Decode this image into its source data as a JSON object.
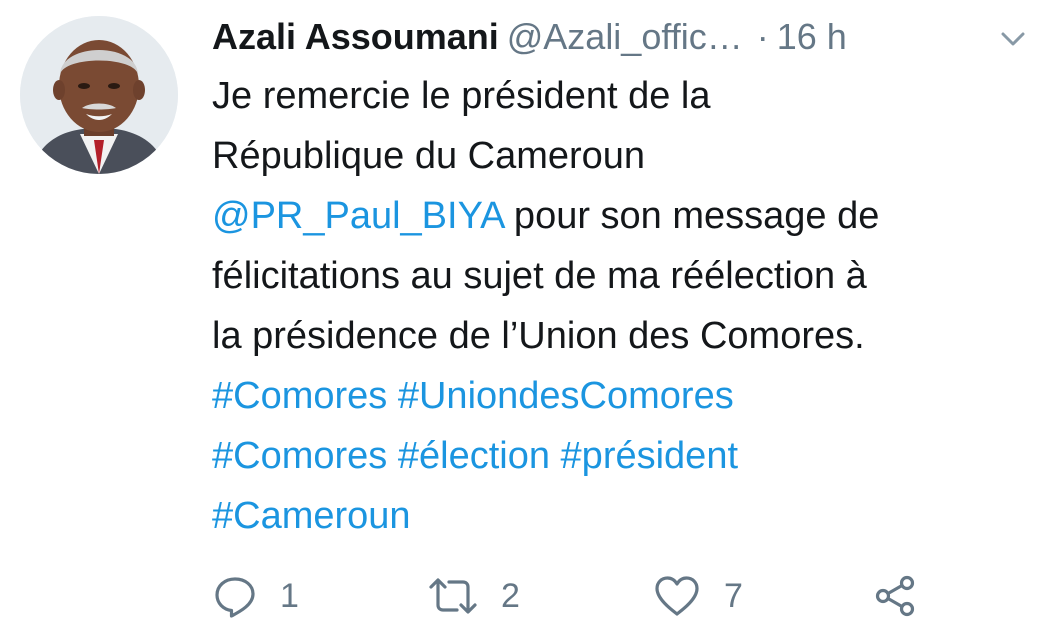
{
  "tweet": {
    "author_name": "Azali Assoumani",
    "handle": "@Azali_offic…",
    "separator": "·",
    "time": "16 h",
    "text_lines": [
      "Je remercie le président de la",
      "République du Cameroun"
    ],
    "mention": "@PR_Paul_BIYA",
    "text_after_mention": " pour son message de",
    "text_lines_2": [
      "félicitations au sujet de ma réélection à",
      "la présidence de l’Union des Comores."
    ],
    "hashtags": {
      "h1": "#Comores",
      "h2": "#UniondesComores",
      "h3": "#Comores",
      "h4": "#élection",
      "h5": "#président",
      "h6": "#Cameroun"
    }
  },
  "actions": {
    "reply_count": "1",
    "retweet_count": "2",
    "like_count": "7"
  },
  "icons": {
    "reply": "reply-icon",
    "retweet": "retweet-icon",
    "like": "heart-icon",
    "share": "share-icon",
    "caret": "chevron-down-icon"
  },
  "colors": {
    "link": "#1b95e0",
    "secondary_text": "#657786",
    "primary_text": "#14171a"
  }
}
